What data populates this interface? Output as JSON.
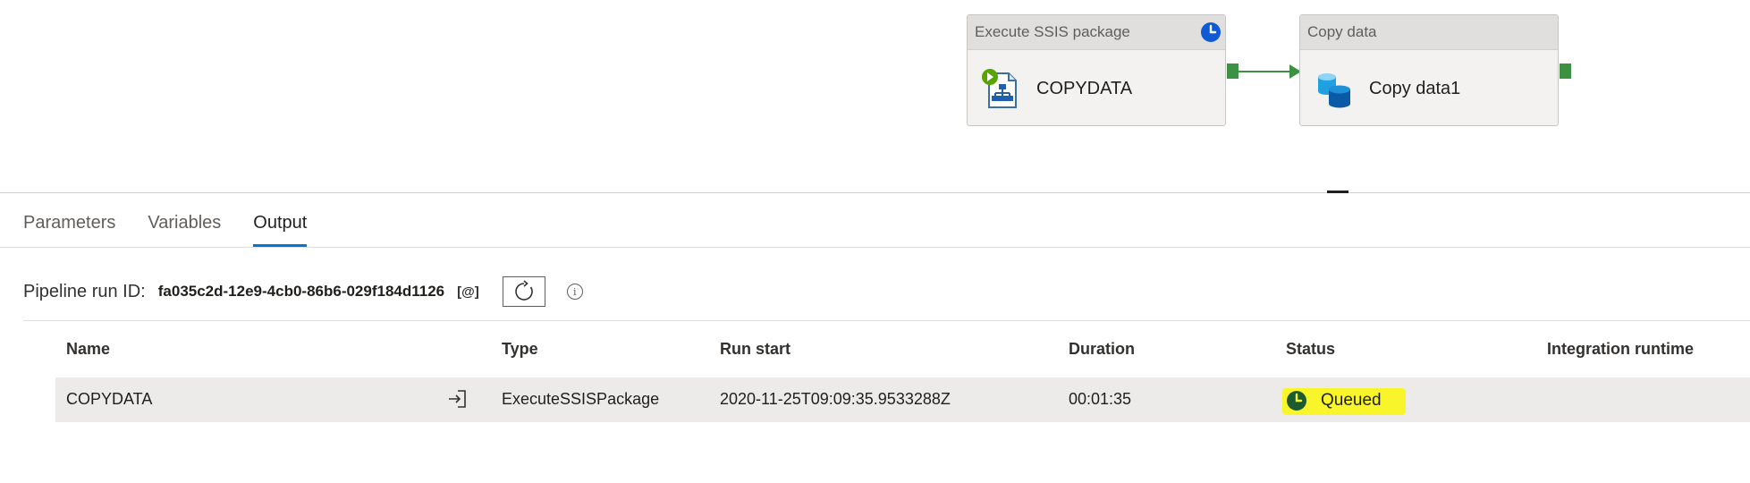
{
  "pipeline": {
    "activities": [
      {
        "type": "Execute SSIS package",
        "name": "COPYDATA",
        "icon": "ssis-package-icon",
        "badge": "clock-icon"
      },
      {
        "type": "Copy data",
        "name": "Copy data1",
        "icon": "database-copy-icon"
      }
    ],
    "connector_color": "#3d9142"
  },
  "tabs": [
    {
      "label": "Parameters",
      "active": false
    },
    {
      "label": "Variables",
      "active": false
    },
    {
      "label": "Output",
      "active": true
    }
  ],
  "run": {
    "label": "Pipeline run ID:",
    "id": "fa035c2d-12e9-4cb0-86b6-029f184d1126",
    "copy_symbol": "[@]",
    "refresh_icon": "refresh-icon",
    "info_symbol": "i"
  },
  "grid": {
    "columns": [
      "Name",
      "Type",
      "Run start",
      "Duration",
      "Status",
      "Integration runtime"
    ],
    "rows": [
      {
        "name": "COPYDATA",
        "type": "ExecuteSSISPackage",
        "run_start": "2020-11-25T09:09:35.9533288Z",
        "duration": "00:01:35",
        "status": "Queued",
        "integration_runtime": ""
      }
    ]
  },
  "colors": {
    "accent": "#0078d4",
    "highlight": "#f8f62a",
    "status_clock": "#1d5a2f"
  }
}
